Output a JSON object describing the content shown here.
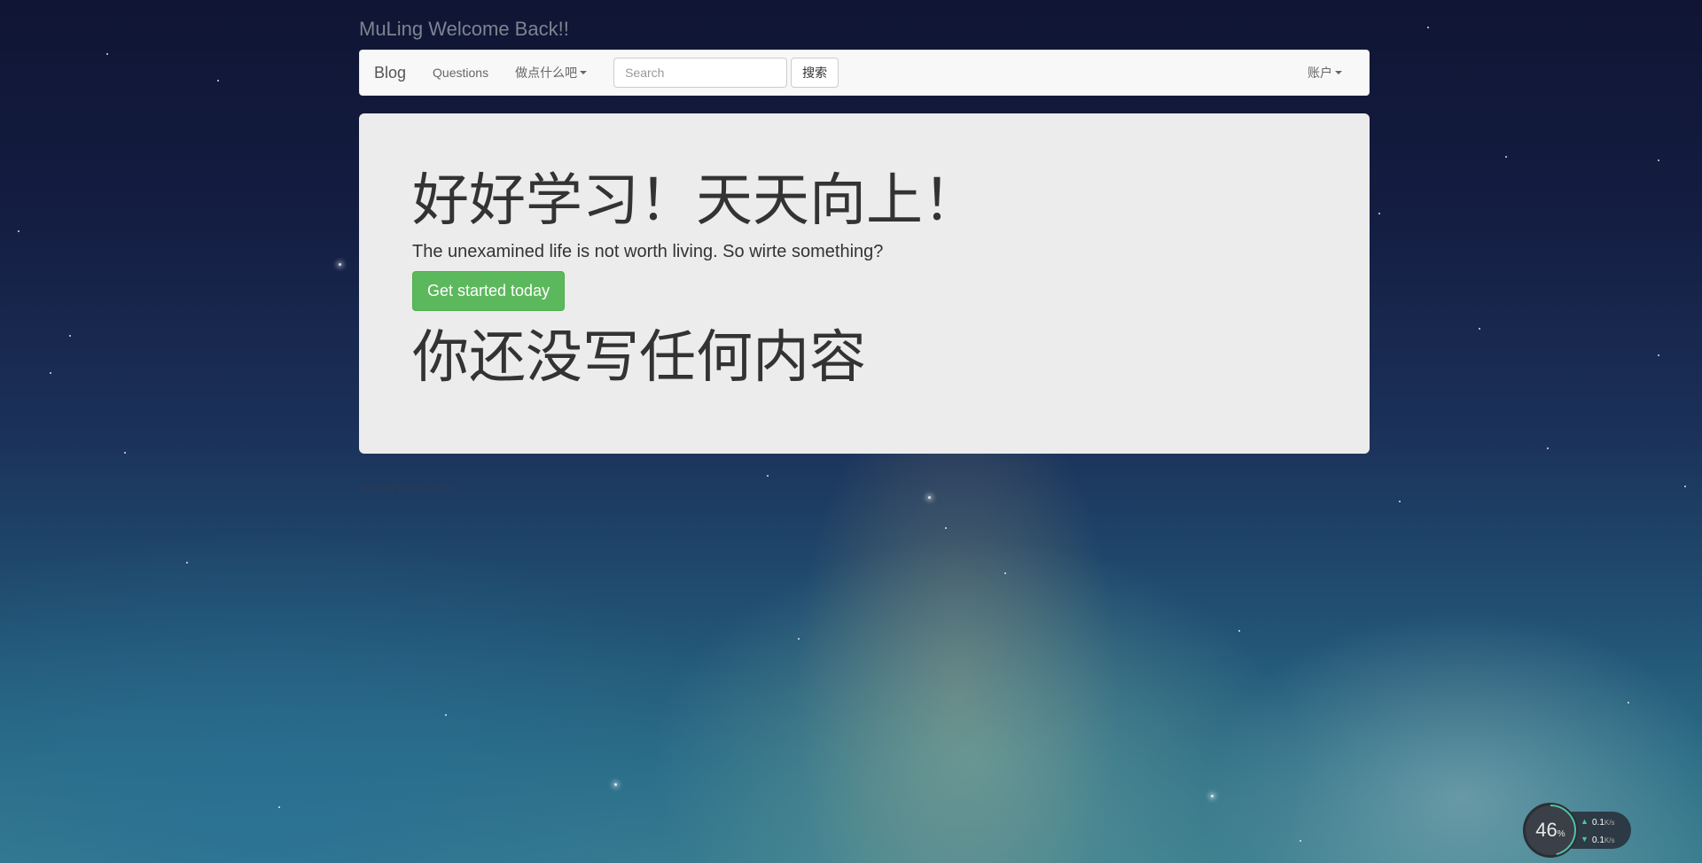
{
  "header": {
    "title": "MuLing Welcome Back!!"
  },
  "navbar": {
    "brand": "Blog",
    "questions": "Questions",
    "dropdown": "做点什么吧",
    "search_placeholder": "Search",
    "search_button": "搜索",
    "account": "账户"
  },
  "jumbotron": {
    "title": "好好学习！天天向上！",
    "subtitle": "The unexamined life is not worth living. So wirte something?",
    "cta": "Get started today",
    "empty_message": "你还没写任何内容"
  },
  "footer": {
    "text": "© Company 2014"
  },
  "widget": {
    "percent": "46",
    "percent_unit": "%",
    "upload": "0.1",
    "download": "0.1",
    "unit": "K/s",
    "accent": "#4fc3a1"
  }
}
